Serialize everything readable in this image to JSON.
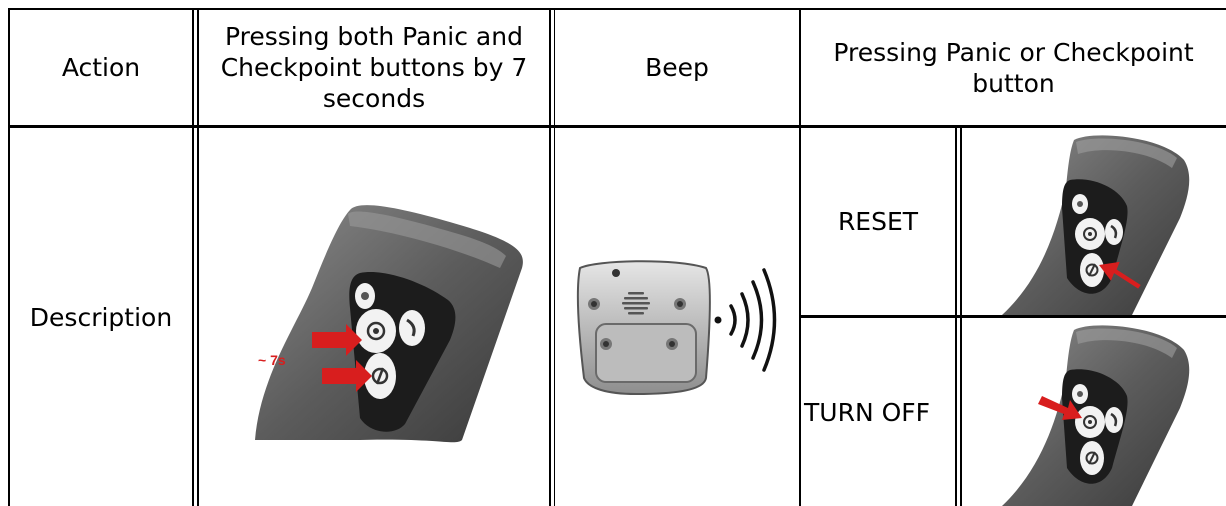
{
  "table": {
    "header": {
      "action": "Action",
      "press_both": "Pressing both Panic and Checkpoint buttons by 7 seconds",
      "beep": "Beep",
      "press_either": "Pressing Panic or Checkpoint button"
    },
    "row": {
      "description": "Description",
      "reset": "RESET",
      "turn_off": "TURN OFF",
      "hold_time": "~ 7s"
    }
  },
  "icons": {
    "panic": "bell-icon",
    "checkpoint": "target-icon",
    "call": "phone-icon",
    "off": "power-icon"
  },
  "colors": {
    "arrow": "#d81e1e",
    "device_body": "#6e6e6e",
    "device_dark": "#2a2a2a",
    "border": "#000000"
  }
}
